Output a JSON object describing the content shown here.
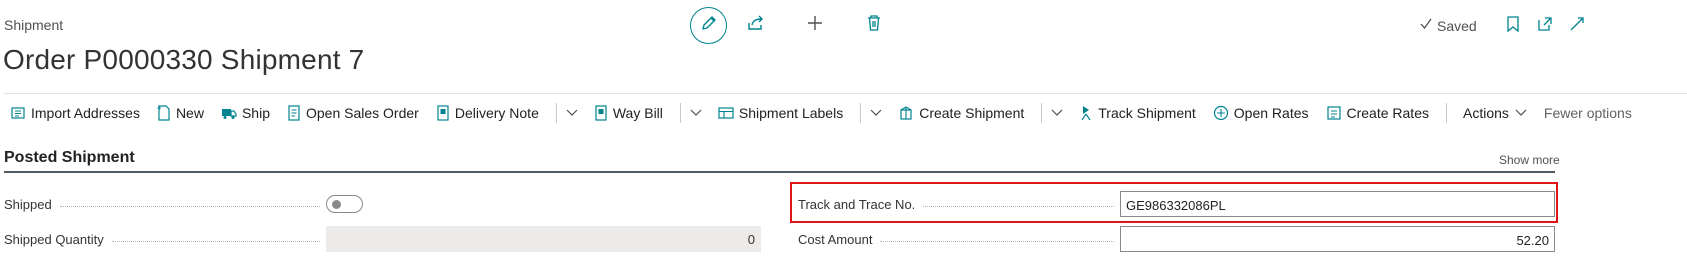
{
  "header": {
    "breadcrumb": "Shipment",
    "title": "Order P0000330 Shipment 7",
    "saved_label": "Saved"
  },
  "actions": [
    {
      "label": "Import Addresses",
      "icon": "import-icon"
    },
    {
      "label": "New",
      "icon": "new-doc-icon"
    },
    {
      "label": "Ship",
      "icon": "truck-icon"
    },
    {
      "label": "Open Sales Order",
      "icon": "document-icon"
    },
    {
      "label": "Delivery Note",
      "icon": "report-icon"
    },
    {
      "label": "Way Bill",
      "icon": "report-icon"
    },
    {
      "label": "Shipment Labels",
      "icon": "label-icon"
    },
    {
      "label": "Create Shipment",
      "icon": "create-shipment-icon"
    },
    {
      "label": "Track Shipment",
      "icon": "track-icon"
    },
    {
      "label": "Open Rates",
      "icon": "rates-icon"
    },
    {
      "label": "Create Rates",
      "icon": "create-rates-icon"
    },
    {
      "label": "Actions",
      "icon": "chevron-down-icon"
    },
    {
      "label": "Fewer options",
      "icon": ""
    }
  ],
  "section": {
    "title": "Posted Shipment",
    "show_more": "Show more"
  },
  "fields": {
    "shipped": {
      "label": "Shipped",
      "value": false
    },
    "shipped_quantity": {
      "label": "Shipped Quantity",
      "value": "0"
    },
    "track_and_trace": {
      "label": "Track and Trace No.",
      "value": "GE986332086PL"
    },
    "cost_amount": {
      "label": "Cost Amount",
      "value": "52.20"
    }
  },
  "colors": {
    "accent": "#00838f",
    "highlight": "#e01515"
  }
}
